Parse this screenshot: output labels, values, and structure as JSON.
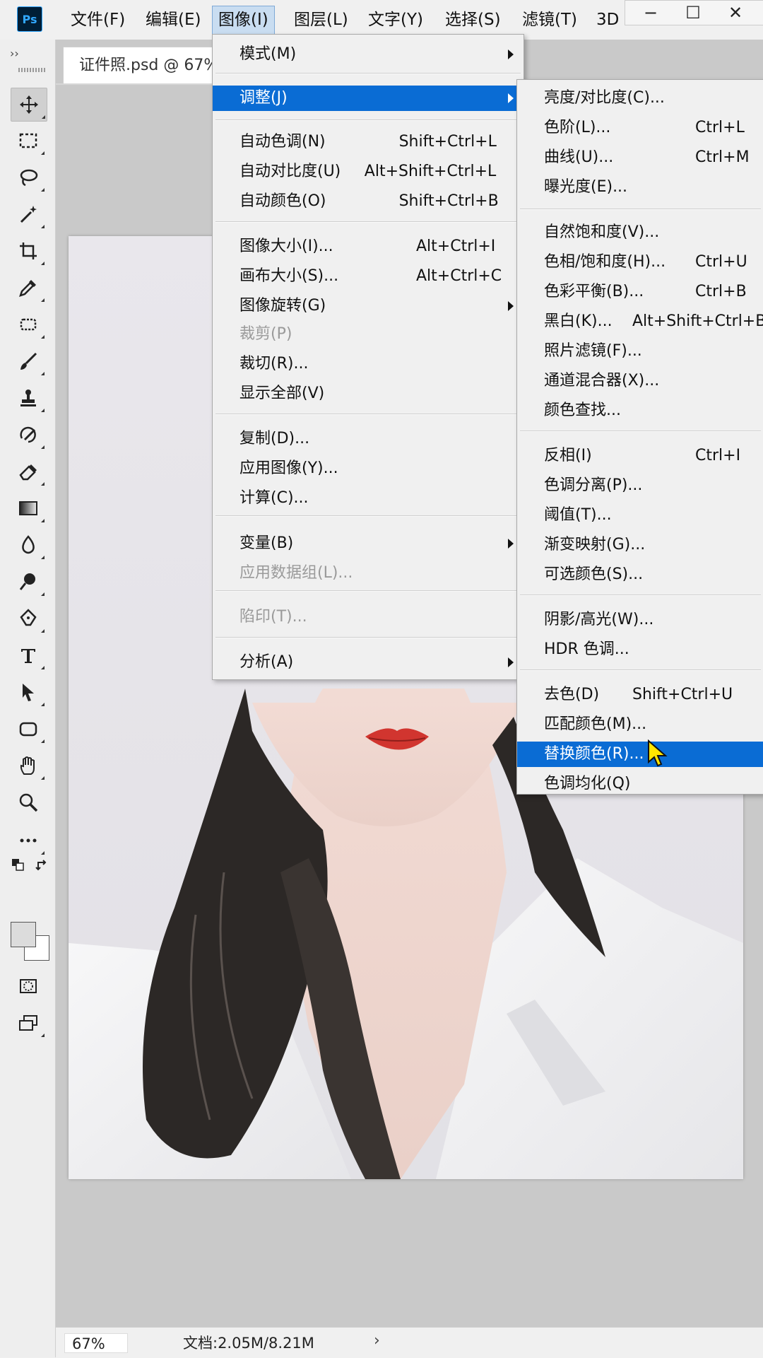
{
  "app": {
    "logo": "Ps"
  },
  "menubar": [
    "文件(F)",
    "编辑(E)",
    "图像(I)",
    "图层(L)",
    "文字(Y)",
    "选择(S)",
    "滤镜(T)",
    "3D"
  ],
  "window_controls": {
    "minimize": "−",
    "maximize": "☐",
    "close": "✕"
  },
  "document": {
    "tab_title": "证件照.psd @ 67%"
  },
  "status": {
    "zoom": "67%",
    "doc_size": "文档:2.05M/8.21M",
    "arrow": "›"
  },
  "image_menu": {
    "items": [
      {
        "label": "模式(M)",
        "shortcut": "",
        "submenu": true
      },
      {
        "label": "调整(J)",
        "shortcut": "",
        "submenu": true,
        "highlight": true
      },
      {
        "label": "自动色调(N)",
        "shortcut": "Shift+Ctrl+L"
      },
      {
        "label": "自动对比度(U)",
        "shortcut": "Alt+Shift+Ctrl+L"
      },
      {
        "label": "自动颜色(O)",
        "shortcut": "Shift+Ctrl+B"
      },
      {
        "label": "图像大小(I)...",
        "shortcut": "Alt+Ctrl+I"
      },
      {
        "label": "画布大小(S)...",
        "shortcut": "Alt+Ctrl+C"
      },
      {
        "label": "图像旋转(G)",
        "shortcut": "",
        "submenu": true
      },
      {
        "label": "裁剪(P)",
        "shortcut": "",
        "disabled": true
      },
      {
        "label": "裁切(R)...",
        "shortcut": ""
      },
      {
        "label": "显示全部(V)",
        "shortcut": ""
      },
      {
        "label": "复制(D)...",
        "shortcut": ""
      },
      {
        "label": "应用图像(Y)...",
        "shortcut": ""
      },
      {
        "label": "计算(C)...",
        "shortcut": ""
      },
      {
        "label": "变量(B)",
        "shortcut": "",
        "submenu": true
      },
      {
        "label": "应用数据组(L)...",
        "shortcut": "",
        "disabled": true
      },
      {
        "label": "陷印(T)...",
        "shortcut": "",
        "disabled": true
      },
      {
        "label": "分析(A)",
        "shortcut": "",
        "submenu": true
      }
    ]
  },
  "adjust_menu": {
    "items": [
      {
        "label": "亮度/对比度(C)...",
        "shortcut": ""
      },
      {
        "label": "色阶(L)...",
        "shortcut": "Ctrl+L"
      },
      {
        "label": "曲线(U)...",
        "shortcut": "Ctrl+M"
      },
      {
        "label": "曝光度(E)...",
        "shortcut": ""
      },
      {
        "label": "自然饱和度(V)...",
        "shortcut": ""
      },
      {
        "label": "色相/饱和度(H)...",
        "shortcut": "Ctrl+U"
      },
      {
        "label": "色彩平衡(B)...",
        "shortcut": "Ctrl+B"
      },
      {
        "label": "黑白(K)...",
        "shortcut": "Alt+Shift+Ctrl+B"
      },
      {
        "label": "照片滤镜(F)...",
        "shortcut": ""
      },
      {
        "label": "通道混合器(X)...",
        "shortcut": ""
      },
      {
        "label": "颜色查找...",
        "shortcut": ""
      },
      {
        "label": "反相(I)",
        "shortcut": "Ctrl+I"
      },
      {
        "label": "色调分离(P)...",
        "shortcut": ""
      },
      {
        "label": "阈值(T)...",
        "shortcut": ""
      },
      {
        "label": "渐变映射(G)...",
        "shortcut": ""
      },
      {
        "label": "可选颜色(S)...",
        "shortcut": ""
      },
      {
        "label": "阴影/高光(W)...",
        "shortcut": ""
      },
      {
        "label": "HDR 色调...",
        "shortcut": ""
      },
      {
        "label": "去色(D)",
        "shortcut": "Shift+Ctrl+U"
      },
      {
        "label": "匹配颜色(M)...",
        "shortcut": ""
      },
      {
        "label": "替换颜色(R)...",
        "shortcut": "",
        "highlight": true
      },
      {
        "label": "色调均化(Q)",
        "shortcut": ""
      }
    ]
  },
  "tools": [
    "move-tool",
    "marquee-tool",
    "lasso-tool",
    "magic-wand-tool",
    "crop-tool",
    "eyedropper-tool",
    "healing-brush-tool",
    "brush-tool",
    "clone-stamp-tool",
    "history-brush-tool",
    "eraser-tool",
    "gradient-tool",
    "blur-tool",
    "dodge-tool",
    "pen-tool",
    "type-tool",
    "path-selection-tool",
    "shape-tool",
    "hand-tool",
    "zoom-tool",
    "more-tools",
    "swap-colors",
    "quick-mask",
    "screen-mode"
  ],
  "colors": {
    "menu_highlight": "#0a6cd4",
    "foreground": "#dcdcdc",
    "background": "#ffffff"
  }
}
